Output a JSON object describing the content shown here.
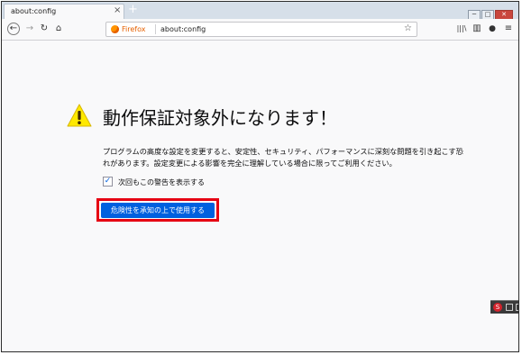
{
  "browser": {
    "tab_title": "about:config",
    "tab_close": "×",
    "new_tab": "+",
    "window_controls": {
      "minimize": "─",
      "maximize": "□",
      "close": "✕"
    }
  },
  "toolbar": {
    "back": "←",
    "forward": "→",
    "reload": "↻",
    "home": "⌂",
    "identity_label": "Firefox",
    "url": "about:config",
    "bookmark_star": "☆",
    "library": "|||\\",
    "sidebar": "▥",
    "account": "●",
    "menu": "≡"
  },
  "warning": {
    "icon": "warning-triangle-icon",
    "icon_color": "#ffe900",
    "heading": "動作保証対象外になります！",
    "description": "プログラムの高度な設定を変更すると、安定性、セキュリティ、パフォーマンスに深刻な問題を引き起こす恐れがあります。設定変更による影響を完全に理解している場合に限ってご利用ください。",
    "checkbox_label": "次回もこの警告を表示する",
    "checkbox_checked": true,
    "checkbox_mark": "✓",
    "accept_button": "危険性を承知の上で使用する",
    "accent_color": "#0060df",
    "highlight_color": "#e60012"
  },
  "tray": {
    "logo": "S"
  }
}
